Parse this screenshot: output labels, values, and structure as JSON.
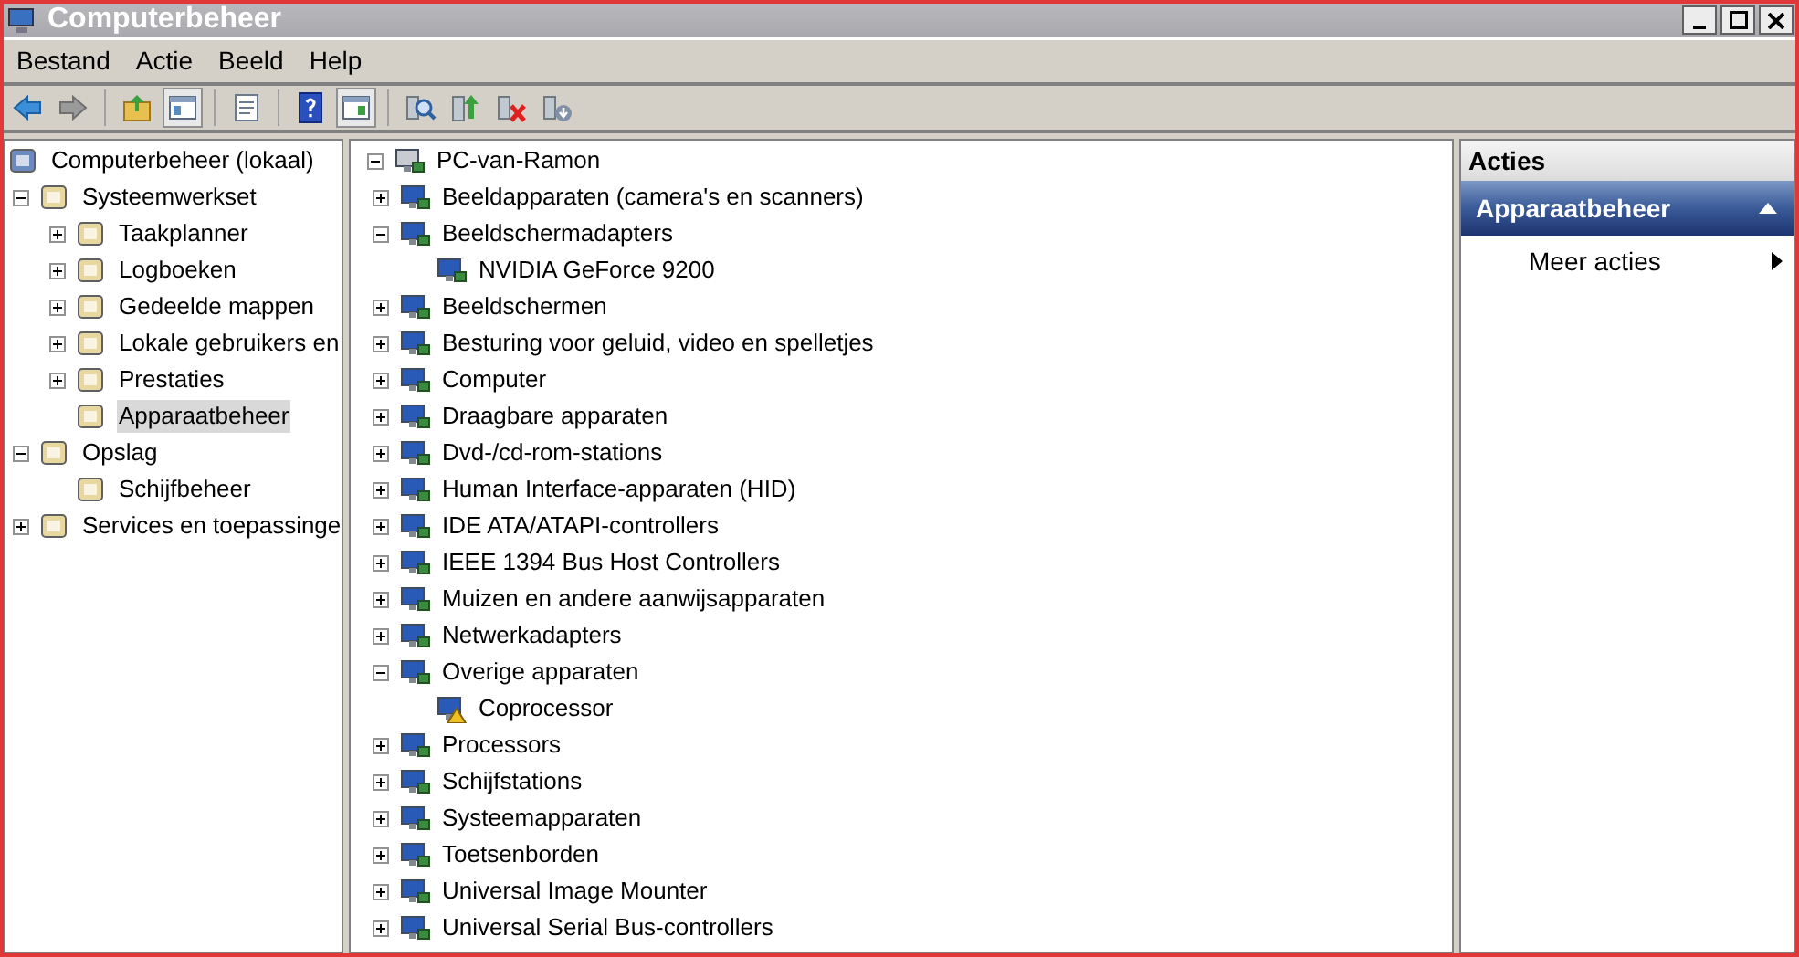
{
  "window": {
    "title": "Computerbeheer"
  },
  "menu": [
    "Bestand",
    "Actie",
    "Beeld",
    "Help"
  ],
  "toolbar": [
    {
      "kind": "back",
      "pressed": false
    },
    {
      "kind": "forward",
      "pressed": false
    },
    {
      "kind": "separator"
    },
    {
      "kind": "up",
      "pressed": false
    },
    {
      "kind": "tree-toggle",
      "pressed": true
    },
    {
      "kind": "separator"
    },
    {
      "kind": "properties",
      "pressed": false
    },
    {
      "kind": "separator"
    },
    {
      "kind": "help",
      "pressed": false
    },
    {
      "kind": "pane-toggle",
      "pressed": true
    },
    {
      "kind": "separator"
    },
    {
      "kind": "scan",
      "pressed": false
    },
    {
      "kind": "update",
      "pressed": false
    },
    {
      "kind": "uninstall",
      "pressed": false
    },
    {
      "kind": "disable",
      "pressed": false
    }
  ],
  "console_tree": [
    {
      "label": "Computerbeheer (lokaal)",
      "selected": false,
      "children": [
        {
          "label": "Systeemwerkset",
          "expanded": true,
          "selected": false,
          "children": [
            {
              "label": "Taakplanner",
              "expanded": false,
              "selected": false
            },
            {
              "label": "Logboeken",
              "expanded": false,
              "selected": false
            },
            {
              "label": "Gedeelde mappen",
              "expanded": false,
              "selected": false
            },
            {
              "label": "Lokale gebruikers en",
              "expanded": false,
              "selected": false
            },
            {
              "label": "Prestaties",
              "expanded": false,
              "selected": false
            },
            {
              "label": "Apparaatbeheer",
              "selected": true
            }
          ]
        },
        {
          "label": "Opslag",
          "expanded": true,
          "selected": false,
          "children": [
            {
              "label": "Schijfbeheer",
              "selected": false
            }
          ]
        },
        {
          "label": "Services en toepassinge",
          "expanded": false,
          "selected": false
        }
      ]
    }
  ],
  "device_tree": [
    {
      "label": "PC-van-Ramon",
      "expanded": true,
      "children": [
        {
          "label": "Beeldapparaten (camera's en scanners)",
          "expanded": false
        },
        {
          "label": "Beeldschermadapters",
          "expanded": true,
          "children": [
            {
              "label": "NVIDIA GeForce 9200"
            }
          ]
        },
        {
          "label": "Beeldschermen",
          "expanded": false
        },
        {
          "label": "Besturing voor geluid, video en spelletjes",
          "expanded": false
        },
        {
          "label": "Computer",
          "expanded": false
        },
        {
          "label": "Draagbare apparaten",
          "expanded": false
        },
        {
          "label": "Dvd-/cd-rom-stations",
          "expanded": false
        },
        {
          "label": "Human Interface-apparaten (HID)",
          "expanded": false
        },
        {
          "label": "IDE ATA/ATAPI-controllers",
          "expanded": false
        },
        {
          "label": "IEEE 1394 Bus Host Controllers",
          "expanded": false
        },
        {
          "label": "Muizen en andere aanwijsapparaten",
          "expanded": false
        },
        {
          "label": "Netwerkadapters",
          "expanded": false
        },
        {
          "label": "Overige apparaten",
          "expanded": true,
          "children": [
            {
              "label": "Coprocessor",
              "warning": true
            }
          ]
        },
        {
          "label": "Processors",
          "expanded": false
        },
        {
          "label": "Schijfstations",
          "expanded": false
        },
        {
          "label": "Systeemapparaten",
          "expanded": false
        },
        {
          "label": "Toetsenborden",
          "expanded": false
        },
        {
          "label": "Universal Image Mounter",
          "expanded": false
        },
        {
          "label": "Universal Serial Bus-controllers",
          "expanded": false
        }
      ]
    }
  ],
  "actions": {
    "title": "Acties",
    "section": {
      "title": "Apparaatbeheer",
      "expanded": true
    },
    "items": [
      "Meer acties"
    ]
  }
}
